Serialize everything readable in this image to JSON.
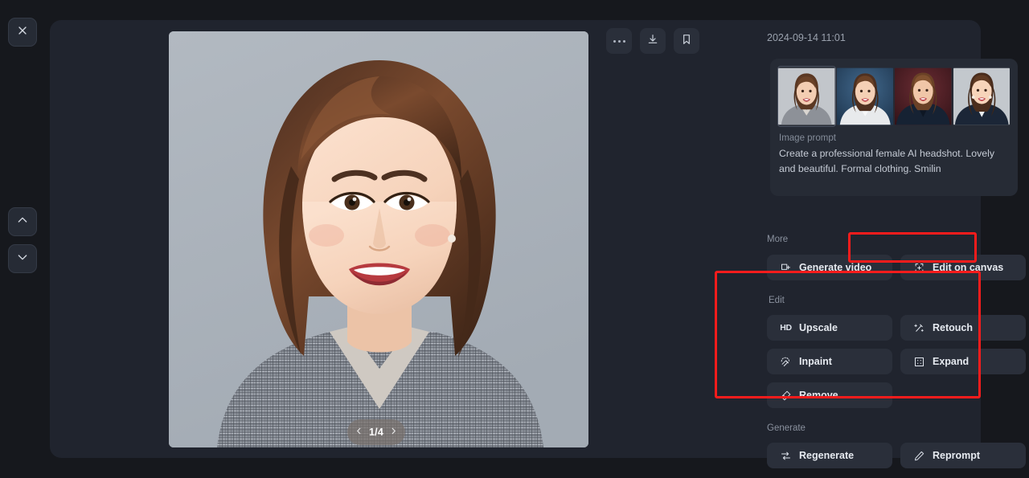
{
  "window": {
    "close_label": "×",
    "background": "#16181d",
    "panel_background": "#20242e",
    "accent_highlight": "#f81c1c"
  },
  "left_rail": {
    "close_icon": "close-icon",
    "prev_icon": "chevron-up-icon",
    "next_icon": "chevron-down-icon"
  },
  "toolbar": {
    "more_label": "more-options-icon",
    "download_label": "download-icon",
    "bookmark_label": "bookmark-icon"
  },
  "viewer": {
    "pager_label": "1/4",
    "page_current": 1,
    "page_total": 4,
    "prev_icon": "chevron-left-icon",
    "next_icon": "chevron-right-icon",
    "image_background": "#aab2bb"
  },
  "details": {
    "timestamp": "2024-09-14 11:01",
    "prompt_label": "Image prompt",
    "prompt_text": "Create a professional female AI headshot. Lovely and beautiful. Formal clothing. Smilin",
    "thumbnails": [
      {
        "name": "variation-1",
        "background": "#c2c6cb",
        "selected": true
      },
      {
        "name": "variation-2",
        "background": "#2b4a66",
        "selected": false
      },
      {
        "name": "variation-3",
        "background": "#4a1f26",
        "selected": false
      },
      {
        "name": "variation-4",
        "background": "#c3c8cd",
        "selected": false
      }
    ]
  },
  "sections": {
    "more": {
      "label": "More",
      "actions": [
        {
          "label": "Generate video",
          "icon": "video-frame-icon"
        },
        {
          "label": "Edit on canvas",
          "icon": "canvas-crop-icon",
          "highlighted": true
        }
      ]
    },
    "edit": {
      "label": "Edit",
      "highlighted": true,
      "actions": [
        {
          "label": "Upscale",
          "icon": "hd-icon"
        },
        {
          "label": "Retouch",
          "icon": "magic-wand-icon"
        },
        {
          "label": "Inpaint",
          "icon": "inpaint-brush-icon"
        },
        {
          "label": "Expand",
          "icon": "expand-square-icon"
        },
        {
          "label": "Remove",
          "icon": "eraser-icon"
        }
      ]
    },
    "generate": {
      "label": "Generate",
      "actions": [
        {
          "label": "Regenerate",
          "icon": "refresh-arrows-icon"
        },
        {
          "label": "Reprompt",
          "icon": "pencil-icon"
        }
      ]
    }
  }
}
